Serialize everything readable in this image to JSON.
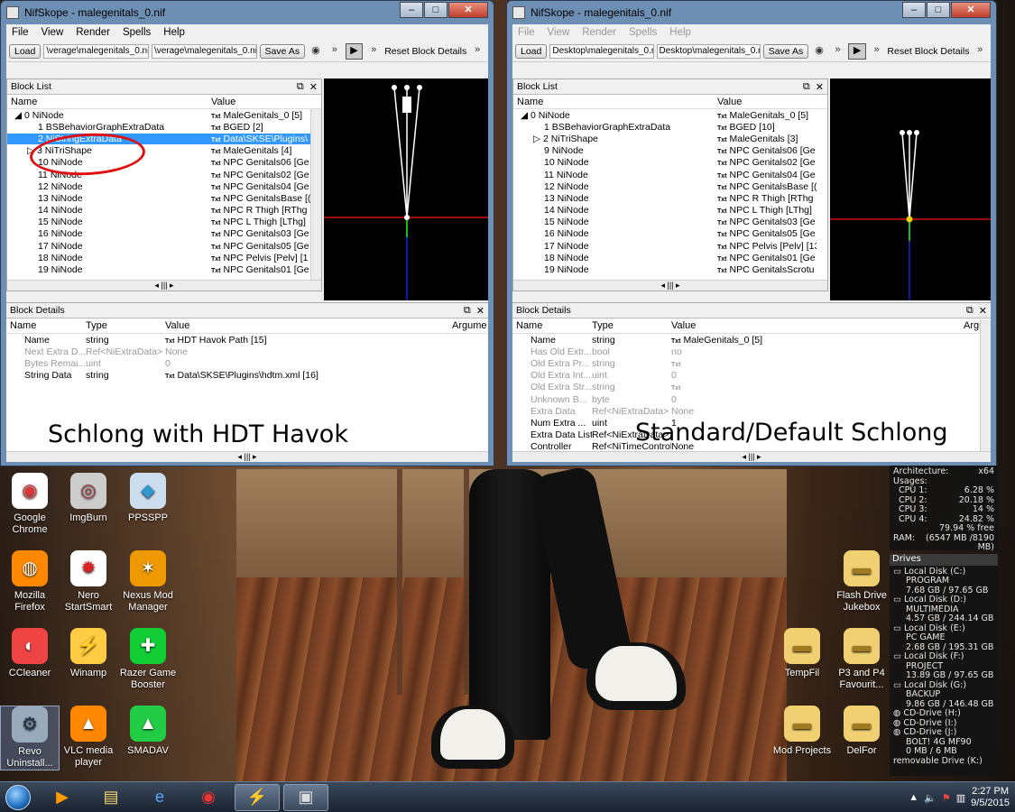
{
  "left_window": {
    "title": "NifSkope - malegenitals_0.nif",
    "menu": [
      "File",
      "View",
      "Render",
      "Spells",
      "Help"
    ],
    "toolbar": {
      "load": "Load",
      "path1": "\\verage\\malegenitals_0.nif",
      "path2": "\\verage\\malegenitals_0.nif",
      "save_as": "Save As",
      "reset": "Reset Block Details"
    },
    "block_list_title": "Block List",
    "col_name": "Name",
    "col_value": "Value",
    "rows": [
      {
        "name": "0 NiNode",
        "value": "MaleGenitals_0 [5]"
      },
      {
        "name": "1 BSBehaviorGraphExtraData",
        "value": "BGED [2]"
      },
      {
        "name": "2 NiStringExtraData",
        "value": "Data\\SKSE\\Plugins\\"
      },
      {
        "name": "3 NiTriShape",
        "value": "MaleGenitals [4]"
      },
      {
        "name": "10 NiNode",
        "value": "NPC Genitals06 [Ge"
      },
      {
        "name": "11 NiNode",
        "value": "NPC Genitals02 [Ge"
      },
      {
        "name": "12 NiNode",
        "value": "NPC Genitals04 [Ge"
      },
      {
        "name": "13 NiNode",
        "value": "NPC GenitalsBase [("
      },
      {
        "name": "14 NiNode",
        "value": "NPC R Thigh [RThg"
      },
      {
        "name": "15 NiNode",
        "value": "NPC L Thigh [LThg]"
      },
      {
        "name": "16 NiNode",
        "value": "NPC Genitals03 [Ge"
      },
      {
        "name": "17 NiNode",
        "value": "NPC Genitals05 [Ge"
      },
      {
        "name": "18 NiNode",
        "value": "NPC Pelvis [Pelv] [1"
      },
      {
        "name": "19 NiNode",
        "value": "NPC Genitals01 [Ge"
      }
    ],
    "details_title": "Block Details",
    "dcols": [
      "Name",
      "Type",
      "Value",
      "Argume"
    ],
    "drows": [
      {
        "name": "Name",
        "type": "string",
        "value": "HDT Havok Path [15]",
        "txt": true
      },
      {
        "name": "Next Extra D...",
        "type": "Ref<NiExtraData>",
        "value": "None",
        "dim": true
      },
      {
        "name": "Bytes Remai...",
        "type": "uint",
        "value": "0",
        "dim": true
      },
      {
        "name": "String Data",
        "type": "string",
        "value": "Data\\SKSE\\Plugins\\hdtm.xml [16]",
        "txt": true
      }
    ],
    "caption": "Schlong with HDT Havok"
  },
  "right_window": {
    "title": "NifSkope - malegenitals_0.nif",
    "menu": [
      "File",
      "View",
      "Render",
      "Spells",
      "Help"
    ],
    "toolbar": {
      "load": "Load",
      "path1": "Desktop\\malegenitals_0.nif",
      "path2": "Desktop\\malegenitals_0.nif",
      "save_as": "Save As",
      "reset": "Reset Block Details"
    },
    "block_list_title": "Block List",
    "col_name": "Name",
    "col_value": "Value",
    "rows": [
      {
        "name": "0 NiNode",
        "value": "MaleGenitals_0 [5]"
      },
      {
        "name": "1 BSBehaviorGraphExtraData",
        "value": "BGED [10]"
      },
      {
        "name": "2 NiTriShape",
        "value": "MaleGenitals [3]"
      },
      {
        "name": "9 NiNode",
        "value": "NPC Genitals06 [Ge"
      },
      {
        "name": "10 NiNode",
        "value": "NPC Genitals02 [Ge"
      },
      {
        "name": "11 NiNode",
        "value": "NPC Genitals04 [Ge"
      },
      {
        "name": "12 NiNode",
        "value": "NPC GenitalsBase [("
      },
      {
        "name": "13 NiNode",
        "value": "NPC R Thigh [RThg"
      },
      {
        "name": "14 NiNode",
        "value": "NPC L Thigh [LThg]"
      },
      {
        "name": "15 NiNode",
        "value": "NPC Genitals03 [Ge"
      },
      {
        "name": "16 NiNode",
        "value": "NPC Genitals05 [Ge"
      },
      {
        "name": "17 NiNode",
        "value": "NPC Pelvis [Pelv] [13"
      },
      {
        "name": "18 NiNode",
        "value": "NPC Genitals01 [Ge"
      },
      {
        "name": "19 NiNode",
        "value": "NPC GenitalsScrotu"
      }
    ],
    "details_title": "Block Details",
    "dcols": [
      "Name",
      "Type",
      "Value",
      "Argu"
    ],
    "drows": [
      {
        "name": "Name",
        "type": "string",
        "value": "MaleGenitals_0 [5]",
        "txt": true
      },
      {
        "name": "Has Old Extr...",
        "type": "bool",
        "value": "no",
        "dim": true
      },
      {
        "name": "Old Extra Pr...",
        "type": "string",
        "value": "",
        "dim": true,
        "txt": true
      },
      {
        "name": "Old Extra Int...",
        "type": "uint",
        "value": "0",
        "dim": true
      },
      {
        "name": "Old Extra Str...",
        "type": "string",
        "value": "",
        "dim": true,
        "txt": true
      },
      {
        "name": "Unknown B...",
        "type": "byte",
        "value": "0",
        "dim": true
      },
      {
        "name": "Extra Data",
        "type": "Ref<NiExtraData>",
        "value": "None",
        "dim": true
      },
      {
        "name": "Num Extra ...",
        "type": "uint",
        "value": "1"
      },
      {
        "name": "Extra Data List",
        "type": "Ref<NiExtraData>",
        "value": ""
      },
      {
        "name": "Controller",
        "type": "Ref<NiTimeController>",
        "value": "None"
      }
    ],
    "caption": "Standard/Default Schlong"
  },
  "desktop_icons": [
    {
      "label": "Google Chrome",
      "icon": "chrome-icon"
    },
    {
      "label": "ImgBurn",
      "icon": "imgburn-icon"
    },
    {
      "label": "PPSSPP",
      "icon": "ppsspp-icon"
    },
    {
      "label": "Mozilla Firefox",
      "icon": "firefox-icon"
    },
    {
      "label": "Nero StartSmart",
      "icon": "nero-icon"
    },
    {
      "label": "Nexus Mod Manager",
      "icon": "nexus-icon"
    },
    {
      "label": "CCleaner",
      "icon": "ccleaner-icon"
    },
    {
      "label": "Winamp",
      "icon": "winamp-icon"
    },
    {
      "label": "Razer Game Booster",
      "icon": "razer-icon"
    },
    {
      "label": "Revo Uninstall...",
      "icon": "revo-icon"
    },
    {
      "label": "VLC media player",
      "icon": "vlc-icon"
    },
    {
      "label": "SMADAV",
      "icon": "smadav-icon"
    },
    {
      "label": "Flash Drive Jukebox",
      "icon": "folder-icon"
    },
    {
      "label": "TempFil",
      "icon": "folder-icon"
    },
    {
      "label": "P3 and P4 Favourit...",
      "icon": "folder-icon"
    },
    {
      "label": "Mod Projects",
      "icon": "folder-icon"
    },
    {
      "label": "DelFor",
      "icon": "folder-icon"
    }
  ],
  "cpu_gadget": {
    "arch_label": "Architecture:",
    "arch": "x64",
    "usages_label": "Usages:",
    "cpus": [
      {
        "label": "CPU 1:",
        "value": "6.28 %"
      },
      {
        "label": "CPU 2:",
        "value": "20.18 %"
      },
      {
        "label": "CPU 3:",
        "value": "14 %"
      },
      {
        "label": "CPU 4:",
        "value": "24.82 %"
      }
    ],
    "free": "79.94 % free",
    "ram_label": "RAM:",
    "ram": "(6547 MB /8190 MB)"
  },
  "drives_gadget": {
    "title": "Drives",
    "drives": [
      {
        "name": "Local Disk (C:)",
        "label": "PROGRAM",
        "size": "7.68 GB / 97.65 GB"
      },
      {
        "name": "Local Disk (D:)",
        "label": "MULTIMEDIA",
        "size": "4.57 GB / 244.14 GB"
      },
      {
        "name": "Local Disk (E:)",
        "label": "PC GAME",
        "size": "2.68 GB / 195.31 GB"
      },
      {
        "name": "Local Disk (F:)",
        "label": "PROJECT",
        "size": "13.89 GB / 97.65 GB"
      },
      {
        "name": "Local Disk (G:)",
        "label": "BACKUP",
        "size": "9.86 GB / 146.48 GB"
      }
    ],
    "cd_drives": [
      "CD-Drive (H:)",
      "CD-Drive (I:)",
      "CD-Drive (J:)"
    ],
    "bolt": "BOLT! 4G MF90",
    "bolt_size": "0 MB / 6 MB",
    "removable": "removable Drive (K:)"
  },
  "taskbar": {
    "time": "2:27 PM",
    "date": "9/5/2015"
  }
}
